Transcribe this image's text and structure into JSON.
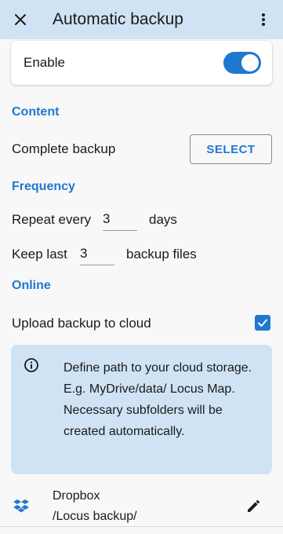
{
  "header": {
    "title": "Automatic backup",
    "close_icon": "close-icon",
    "more_icon": "more-vert-icon"
  },
  "enable": {
    "label": "Enable",
    "on": true
  },
  "content_section": {
    "title": "Content",
    "complete_backup_label": "Complete backup",
    "select_label": "SELECT"
  },
  "frequency_section": {
    "title": "Frequency",
    "repeat_prefix": "Repeat every",
    "repeat_value": "3",
    "repeat_suffix": "days",
    "keep_prefix": "Keep last",
    "keep_value": "3",
    "keep_suffix": "backup files"
  },
  "online_section": {
    "title": "Online",
    "upload_label": "Upload backup to cloud",
    "upload_checked": true
  },
  "info": {
    "icon": "info-icon",
    "text": "Define path to your cloud storage. E.g. MyDrive/data/ Locus Map. Necessary subfolders will be created automatically."
  },
  "cloud": {
    "icon": "dropbox-icon",
    "name": "Dropbox",
    "path": "/Locus backup/",
    "edit_icon": "pencil-icon"
  },
  "colors": {
    "accent": "#1e78d0",
    "header_bg": "#cfe3f5",
    "info_bg": "#cfe3f5",
    "background": "#f8f8f8"
  }
}
